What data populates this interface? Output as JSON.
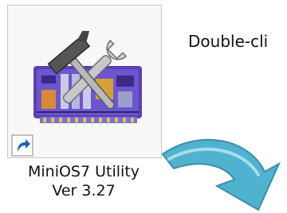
{
  "desktop_icon": {
    "name_line1": "MiniOS7 Utility",
    "name_line2": "Ver 3.27",
    "icon": "tools-on-circuit-board-icon",
    "badge_icon": "shortcut-arrow-icon"
  },
  "instruction": {
    "text": "Double-cli"
  },
  "arrow": {
    "icon": "curved-arrow-down-icon",
    "color": "#4fb2cf"
  }
}
